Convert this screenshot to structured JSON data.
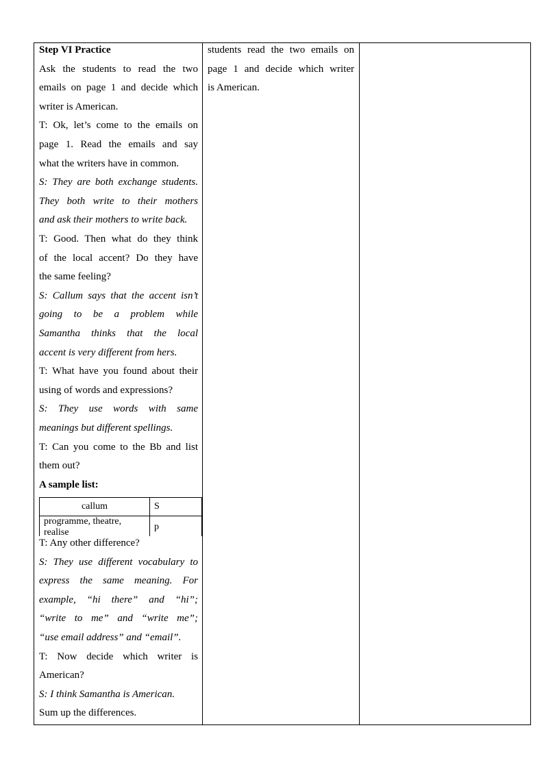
{
  "col1_lines_top": [
    {
      "text": "Step VI Practice",
      "style": "b"
    },
    {
      "text": "Ask the students to read the two",
      "style": "j"
    },
    {
      "text": "emails on page 1 and decide which",
      "style": "j"
    },
    {
      "text": "writer is American.",
      "style": ""
    },
    {
      "text": "T: Ok, let’s come to the emails on",
      "style": "j"
    },
    {
      "text": "page 1. Read the emails and say",
      "style": "j"
    },
    {
      "text": "what the writers have in common.",
      "style": ""
    },
    {
      "text": "S: They are both exchange students.",
      "style": "i j"
    },
    {
      "text": "They both write to their mothers",
      "style": "i j"
    },
    {
      "text": "and ask their mothers to write back.",
      "style": "i"
    },
    {
      "text": "T: Good. Then what do they think",
      "style": "j"
    },
    {
      "text": "of the local accent? Do they have",
      "style": "j"
    },
    {
      "text": "the same feeling?",
      "style": ""
    },
    {
      "text": "S: Callum says that the accent isn’t",
      "style": "i j"
    },
    {
      "text": "going to be a problem while",
      "style": "i j"
    },
    {
      "text": "Samantha thinks that the local",
      "style": "i j"
    },
    {
      "text": "accent is very different from hers.",
      "style": "i"
    },
    {
      "text": "T: What have you found about their",
      "style": "j"
    },
    {
      "text": "using of words and expressions?",
      "style": ""
    },
    {
      "text": "S: They use words with same",
      "style": "i j"
    },
    {
      "text": "meanings but different spellings.",
      "style": "i"
    },
    {
      "text": "T: Can you come to the Bb and list",
      "style": "j"
    },
    {
      "text": "them out?",
      "style": ""
    },
    {
      "text": "A sample list:",
      "style": "b"
    }
  ],
  "sample_table": {
    "rows": [
      [
        "callum",
        "S"
      ],
      [
        "programme, theatre, realise",
        "p"
      ]
    ]
  },
  "col1_lines_bottom": [
    {
      "text": "T: Any other difference?",
      "style": ""
    },
    {
      "text": "S: They use different vocabulary to",
      "style": "i j"
    },
    {
      "text": "express the same meaning. For",
      "style": "i j"
    },
    {
      "text": "example, “hi there” and “hi”;",
      "style": "i j"
    },
    {
      "text": "“write to me” and “write me”;",
      "style": "i j"
    },
    {
      "text": "“use email address” and “email”.",
      "style": "i"
    },
    {
      "text": "T: Now decide which writer is",
      "style": "j"
    },
    {
      "text": "American?",
      "style": ""
    },
    {
      "text": "S: I think Samantha is American.",
      "style": "i"
    },
    {
      "text": "Sum up the differences.",
      "style": ""
    }
  ],
  "col2_lines": [
    {
      "text": "students read the two emails on",
      "style": "j"
    },
    {
      "text": "page 1 and decide which writer",
      "style": "j"
    },
    {
      "text": "is American.",
      "style": ""
    }
  ]
}
